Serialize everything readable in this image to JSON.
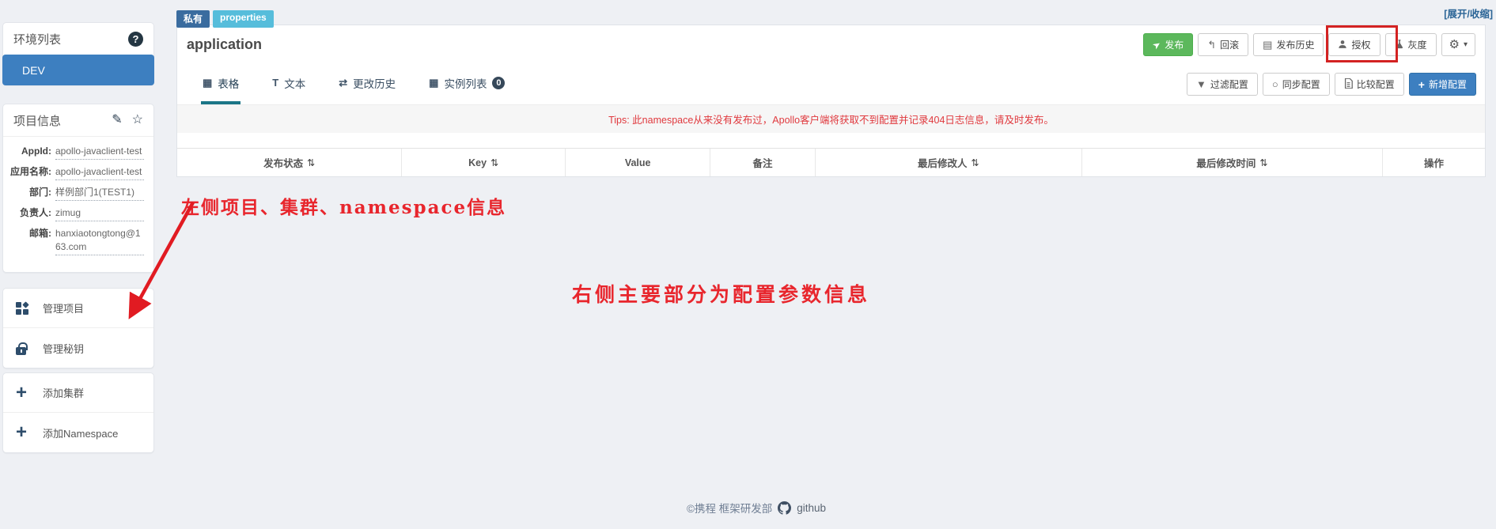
{
  "page": {
    "expand_collapse_link": "[展开/收缩]"
  },
  "icons": {
    "help": "?",
    "edit": "✎",
    "star": "☆",
    "publish": "➤",
    "rollback": "↰",
    "history": "▤",
    "gear": "⚙",
    "caret": "▾",
    "tab_table": "▦",
    "tab_text": "T",
    "tab_change": "⇄",
    "tab_instances": "▦",
    "sync": "○",
    "plus": "+",
    "sort": "⇅",
    "filter": "▼"
  },
  "sidebar": {
    "env": {
      "title": "环境列表",
      "items": [
        {
          "label": "DEV"
        }
      ]
    },
    "project": {
      "title": "项目信息",
      "fields": [
        {
          "label": "AppId:",
          "value": "apollo-javaclient-test"
        },
        {
          "label": "应用名称:",
          "value": "apollo-javaclient-test"
        },
        {
          "label": "部门:",
          "value": "样例部门1(TEST1)"
        },
        {
          "label": "负责人:",
          "value": "zimug"
        },
        {
          "label": "邮箱:",
          "value": "hanxiaotongtong@163.com"
        }
      ]
    },
    "menus": {
      "manage_project": "管理项目",
      "manage_secret": "管理秘钥",
      "add_cluster": "添加集群",
      "add_namespace": "添加Namespace"
    }
  },
  "main": {
    "badges": {
      "type": "私有",
      "format": "properties"
    },
    "title": "application",
    "actions": {
      "publish": "发布",
      "rollback": "回滚",
      "release_history": "发布历史",
      "grant": "授权",
      "gray_release": "灰度"
    },
    "tabs": {
      "table": "表格",
      "text": "文本",
      "change_history": "更改历史",
      "instances": "实例列表",
      "instances_count": "0"
    },
    "config_actions": {
      "filter": "过滤配置",
      "sync": "同步配置",
      "diff": "比较配置",
      "add": "新增配置"
    },
    "tips": "Tips: 此namespace从来没有发布过，Apollo客户端将获取不到配置并记录404日志信息，请及时发布。",
    "table": {
      "headers": [
        {
          "label": "发布状态",
          "sortable": true
        },
        {
          "label": "Key",
          "sortable": true
        },
        {
          "label": "Value",
          "sortable": false
        },
        {
          "label": "备注",
          "sortable": false
        },
        {
          "label": "最后修改人",
          "sortable": true
        },
        {
          "label": "最后修改时间",
          "sortable": true
        },
        {
          "label": "操作",
          "sortable": false
        }
      ],
      "rows": []
    }
  },
  "annotations": {
    "left_note": "左侧项目、集群、namespace信息",
    "right_note": "右侧主要部分为配置参数信息",
    "highlight_color": "#d32222",
    "note_color": "#e8262d"
  },
  "footer": {
    "copyright": "©携程 框架研发部",
    "github": "github"
  },
  "colors": {
    "page_background": "#eef0f4",
    "primary": "#3d7fc0",
    "success": "#5cb85c",
    "badge_private": "#3a6c9f",
    "badge_format": "#56bddb",
    "tab_active_underline": "#1b7687",
    "tips_text": "#e0393e"
  }
}
